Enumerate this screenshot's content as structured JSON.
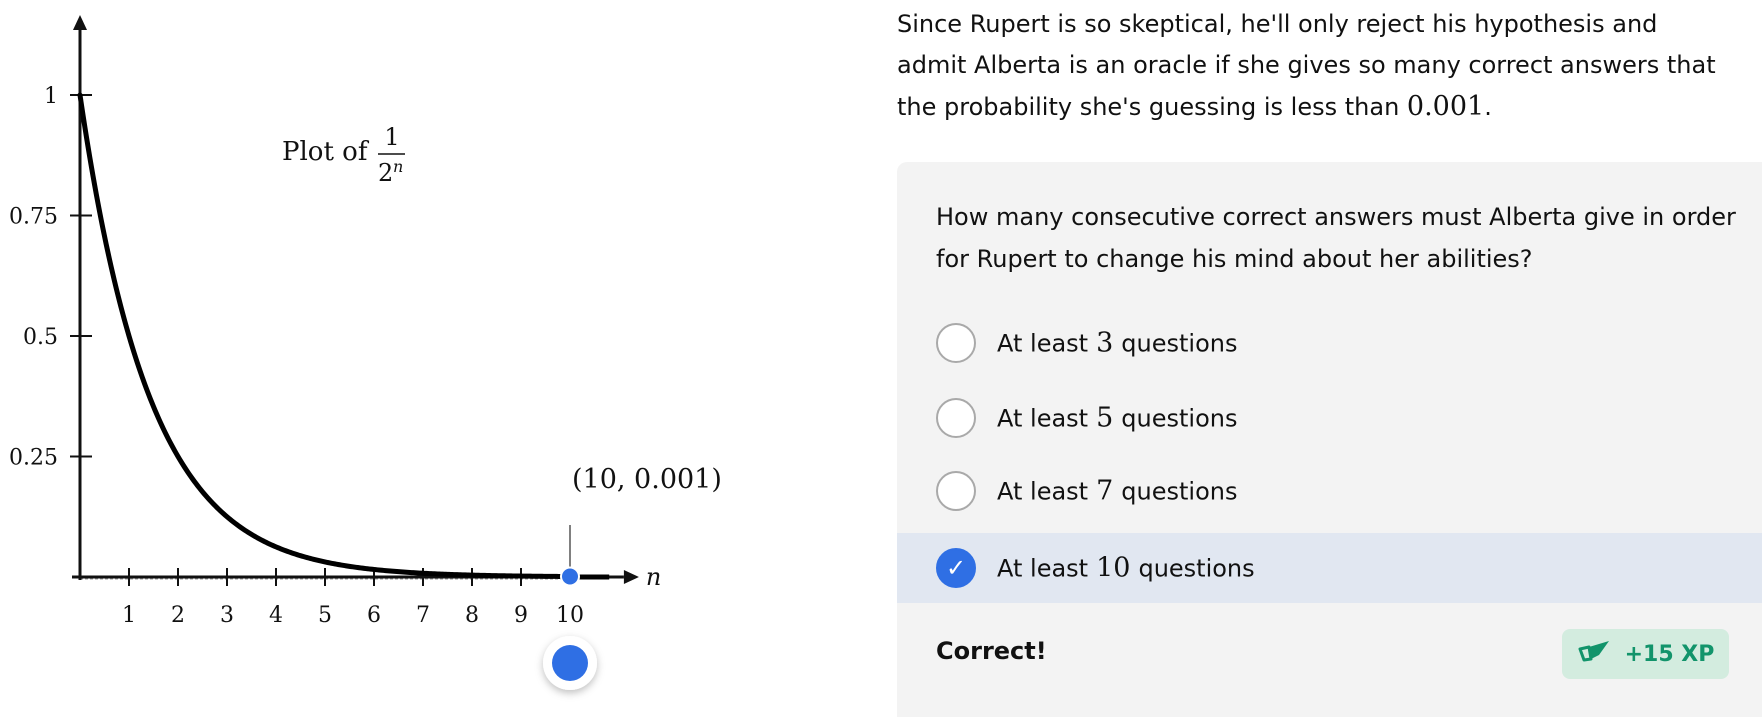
{
  "intro": {
    "text_before": "Since Rupert is so skeptical, he'll only reject his hypothesis and admit Alberta is an oracle if she gives so many correct answers that the probability she's guessing is less than ",
    "math": "0.001",
    "text_after": "."
  },
  "question": "How many consecutive correct answers must Alberta give in order for Rupert to change his mind about her abilities?",
  "options": [
    {
      "prefix": "At least",
      "number": "3",
      "suffix": "questions",
      "selected": false
    },
    {
      "prefix": "At least",
      "number": "5",
      "suffix": "questions",
      "selected": false
    },
    {
      "prefix": "At least",
      "number": "7",
      "suffix": "questions",
      "selected": false
    },
    {
      "prefix": "At least",
      "number": "10",
      "suffix": "questions",
      "selected": true
    }
  ],
  "result": {
    "text": "Correct!",
    "xp": "+15 XP"
  },
  "chart_data": {
    "type": "line",
    "function": "1/2^n",
    "title_prefix": "Plot of",
    "title_numerator": "1",
    "title_base": "2",
    "title_exponent": "n",
    "xlabel": "n",
    "ylabel": "",
    "xlim": [
      0,
      11.4
    ],
    "ylim": [
      0,
      1.15
    ],
    "x_ticks": [
      1,
      2,
      3,
      4,
      5,
      6,
      7,
      8,
      9,
      10
    ],
    "y_ticks": [
      {
        "value": 0.25,
        "label": "0.25"
      },
      {
        "value": 0.5,
        "label": "0.5"
      },
      {
        "value": 0.75,
        "label": "0.75"
      },
      {
        "value": 1,
        "label": "1"
      }
    ],
    "highlight_point": {
      "x": 10,
      "y": 0.001,
      "label": "(10, 0.001)"
    },
    "slider_value": 10,
    "colors": {
      "curve": "#000000",
      "point": "#2f6fe4"
    }
  },
  "colors": {
    "accent": "#2f6fe4",
    "selected_bg": "#e1e7f1",
    "xp_bg": "#d3ecdf",
    "xp_text": "#12946b"
  },
  "icons": {
    "check": "check-icon",
    "xp": "pencil-icon"
  }
}
